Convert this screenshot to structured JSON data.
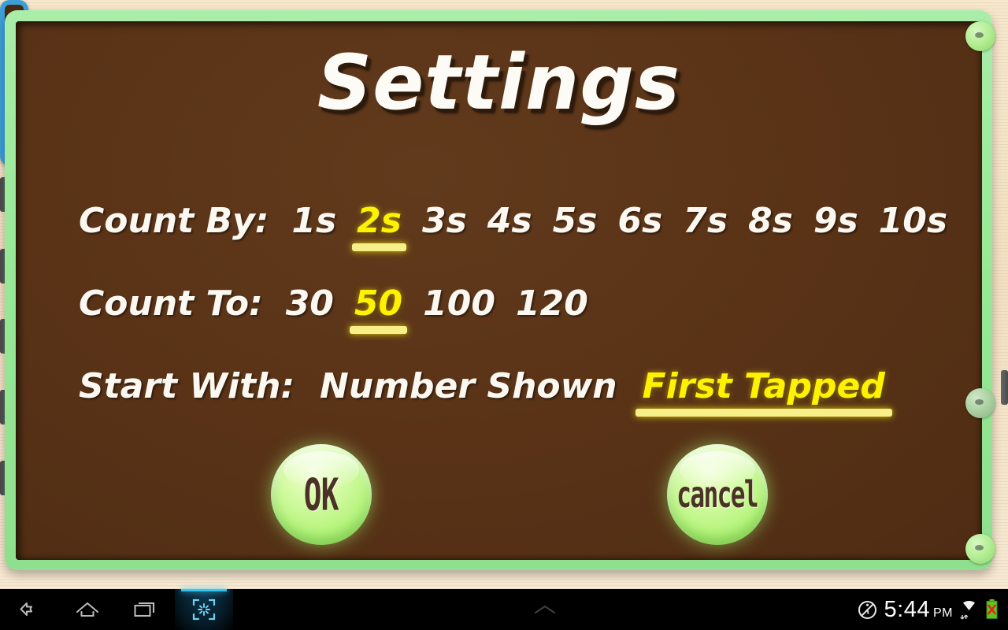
{
  "app": {
    "title": "Settings"
  },
  "settings": {
    "rows": [
      {
        "id": "count-by",
        "label": "Count By:",
        "selected": "2s",
        "options": [
          "1s",
          "2s",
          "3s",
          "4s",
          "5s",
          "6s",
          "7s",
          "8s",
          "9s",
          "10s"
        ]
      },
      {
        "id": "count-to",
        "label": "Count To:",
        "selected": "50",
        "options": [
          "30",
          "50",
          "100",
          "120"
        ]
      },
      {
        "id": "start-with",
        "label": "Start With:",
        "selected": "First Tapped",
        "options": [
          "Number Shown",
          "First Tapped"
        ]
      }
    ]
  },
  "buttons": {
    "ok_label": "OK",
    "cancel_label": "cancel"
  },
  "colors": {
    "board": "#5a3317",
    "frame_green": "#95e895",
    "selected_yellow": "#fff200",
    "underline_yellow": "#f7f089",
    "text_white": "#fbf8f1",
    "desk_beige": "#f3e0c3",
    "button_green": "#b9f581",
    "accent_blue": "#35c6f4"
  },
  "statusbar": {
    "time": "5:44",
    "ampm": "PM",
    "icons": [
      "mute-icon",
      "wifi-icon",
      "battery-error-icon"
    ]
  },
  "navbar": {
    "items": [
      {
        "id": "back",
        "icon": "back-arrow-icon"
      },
      {
        "id": "home",
        "icon": "home-icon"
      },
      {
        "id": "recents",
        "icon": "recents-icon"
      },
      {
        "id": "screenshot",
        "icon": "screenshot-icon"
      }
    ],
    "peek_icon": "chevron-up-icon"
  }
}
